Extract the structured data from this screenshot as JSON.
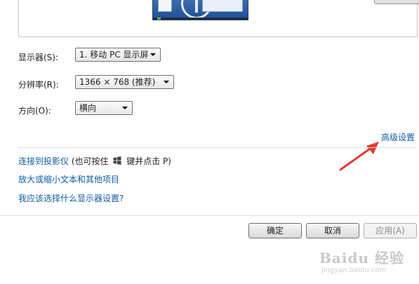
{
  "display": {
    "monitor_label": "显示器(S):",
    "monitor_value": "1. 移动 PC 显示屏",
    "resolution_label": "分辨率(R):",
    "resolution_value": "1366 × 768 (推荐)",
    "orientation_label": "方向(O):",
    "orientation_value": "横向"
  },
  "links": {
    "advanced": "高级设置",
    "projector_link": "连接到投影仪",
    "projector_hint_before": "(也可按住",
    "projector_hint_after": "键并点击 P)",
    "text_size": "放大或缩小文本和其他项目",
    "which_settings": "我应该选择什么显示器设置?"
  },
  "buttons": {
    "ok": "确定",
    "cancel": "取消",
    "apply": "应用(A)"
  },
  "watermark": {
    "logo": "Baidu 经验",
    "url": "jingyan.baidu.com"
  },
  "colors": {
    "link": "#0f5ca8",
    "annotation_arrow": "#e53935"
  }
}
